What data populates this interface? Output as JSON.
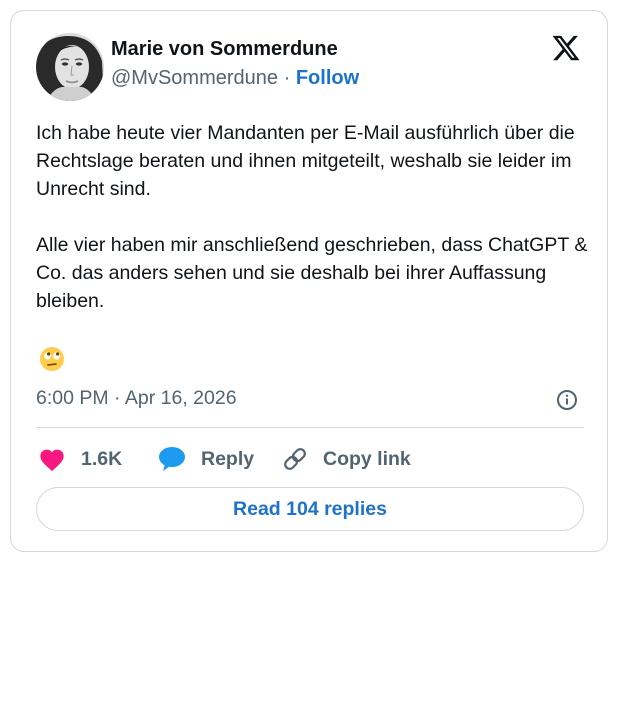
{
  "tweet": {
    "author_name": "Marie von Sommerdune",
    "handle": "@MvSommerdune",
    "separator": "·",
    "follow_label": "Follow",
    "paragraph1": "Ich habe heute vier Mandanten per E-Mail ausführlich über die Rechtslage beraten und ihnen mitgeteilt, weshalb sie leider im Unrecht sind.",
    "paragraph2": "Alle vier haben mir anschließend geschrieben, dass ChatGPT & Co. das anders sehen und sie deshalb bei ihrer Auffassung bleiben.",
    "emoji": "face-with-rolling-eyes",
    "timestamp": "6:00 PM · Apr 16, 2026"
  },
  "actions": {
    "like_count": "1.6K",
    "reply_label": "Reply",
    "copy_link_label": "Copy link",
    "read_replies_label": "Read 104 replies"
  },
  "colors": {
    "link_blue": "#1d72c9",
    "like_pink": "#f91880",
    "reply_blue": "#1d9bf0",
    "muted": "#536471",
    "border": "#cfd9de"
  },
  "icons": [
    "x-logo-icon",
    "info-icon",
    "heart-icon",
    "reply-bubble-icon",
    "link-icon",
    "rolling-eyes-emoji"
  ]
}
